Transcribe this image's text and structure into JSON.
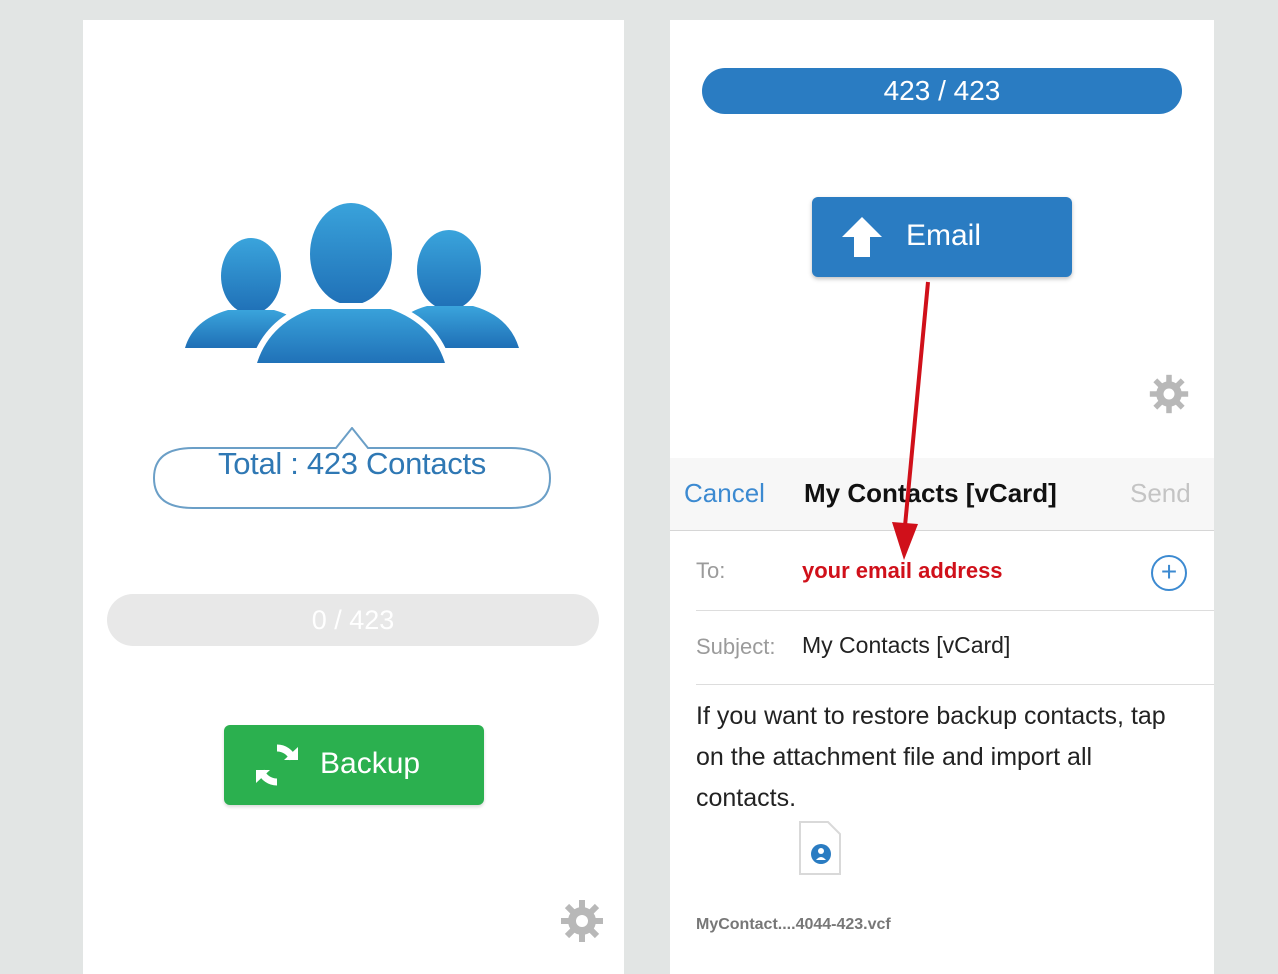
{
  "left_screen": {
    "total_label": "Total : 423 Contacts",
    "progress_text": "0 / 423",
    "backup_button": "Backup",
    "icons": {
      "contacts": "contacts-group-icon",
      "backup": "sync-icon",
      "settings": "gear-icon"
    },
    "colors": {
      "backup_button": "#2bb04f",
      "accent": "#2f78b4"
    }
  },
  "right_screen": {
    "progress_text": "423 / 423",
    "email_button": "Email",
    "icons": {
      "email": "upload-arrow-icon",
      "settings": "gear-icon",
      "attachment": "contact-file-icon",
      "add": "add-recipient-icon"
    },
    "compose": {
      "cancel": "Cancel",
      "title": "My Contacts [vCard]",
      "send": "Send",
      "to_label": "To:",
      "to_value": "your email address",
      "subject_label": "Subject:",
      "subject_value": "My Contacts [vCard]",
      "body": "If you want to restore backup contacts, tap on the attachment file and import all contacts.",
      "attachment_name": "MyContact....4044-423.vcf"
    },
    "colors": {
      "progress": "#2a7cc2",
      "annotation": "#d0101a",
      "link": "#3c8ad1"
    }
  }
}
